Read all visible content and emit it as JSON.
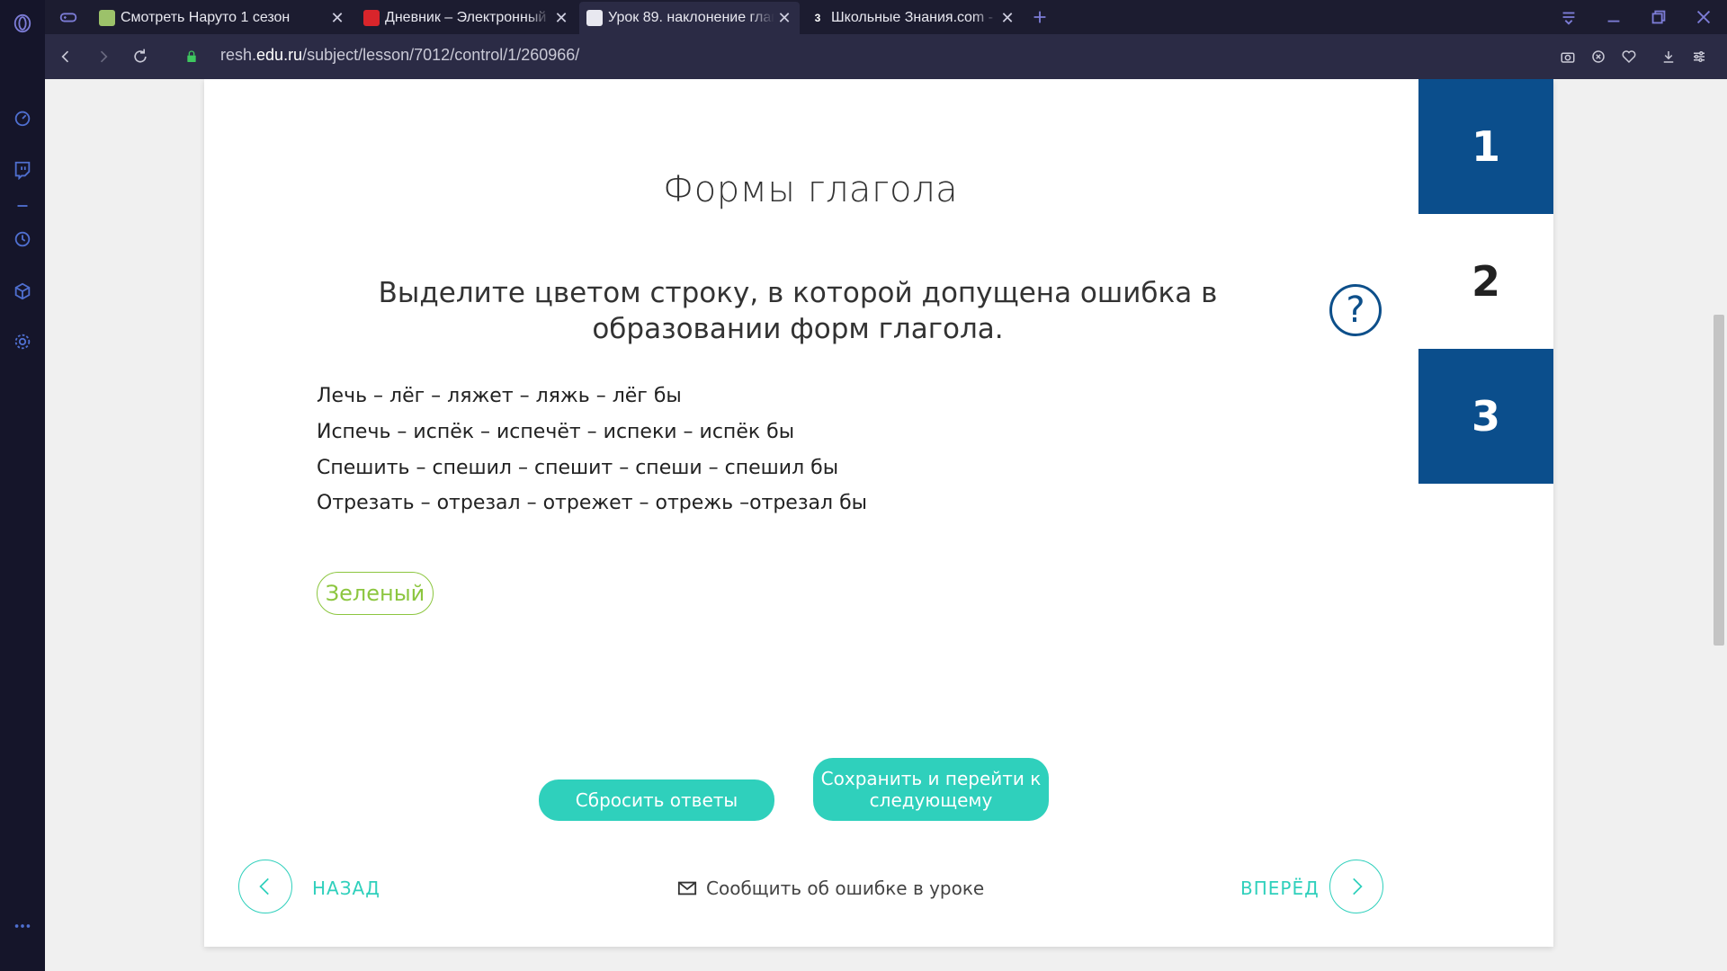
{
  "browser": {
    "tabs": [
      {
        "title": "Смотреть Наруто 1 сезон",
        "favicon": "naruto-favicon"
      },
      {
        "title": "Дневник – Электронный ж",
        "favicon": "diary-favicon"
      },
      {
        "title": "Урок 89. наклонение глаго",
        "favicon": "resh-favicon"
      },
      {
        "title": "Школьные Знания.com - Р",
        "favicon": "znanija-favicon",
        "favicon_text": "3"
      }
    ],
    "url_prefix": "resh.",
    "url_domain": "edu.ru",
    "url_path": "/subject/lesson/7012/control/1/260966/"
  },
  "task": {
    "title": "Формы глагола",
    "question": "Выделите цветом строку, в которой допущена ошибка в образовании форм глагола.",
    "help_symbol": "?",
    "options": [
      "Лечь – лёг – ляжет – ляжь – лёг бы",
      "Испечь – испёк – испечёт – испеки – испёк бы",
      "Спешить – спешил – спешит – спеши – спешил бы",
      "Отрезать – отрезал – отрежет – отрежь –отрезал бы"
    ],
    "answer_color_label": "Зеленый",
    "reset_label": "Сбросить ответы",
    "save_label": "Сохранить и перейти к следующему"
  },
  "footer": {
    "back_label": "НАЗАД",
    "forward_label": "ВПЕРЁД",
    "report_label": "Сообщить об ошибке в уроке"
  },
  "steps": [
    "1",
    "2",
    "3"
  ],
  "colors": {
    "accent_teal": "#2fd0bc",
    "step_blue": "#0b4e8c",
    "answer_green": "#8cc63f"
  }
}
